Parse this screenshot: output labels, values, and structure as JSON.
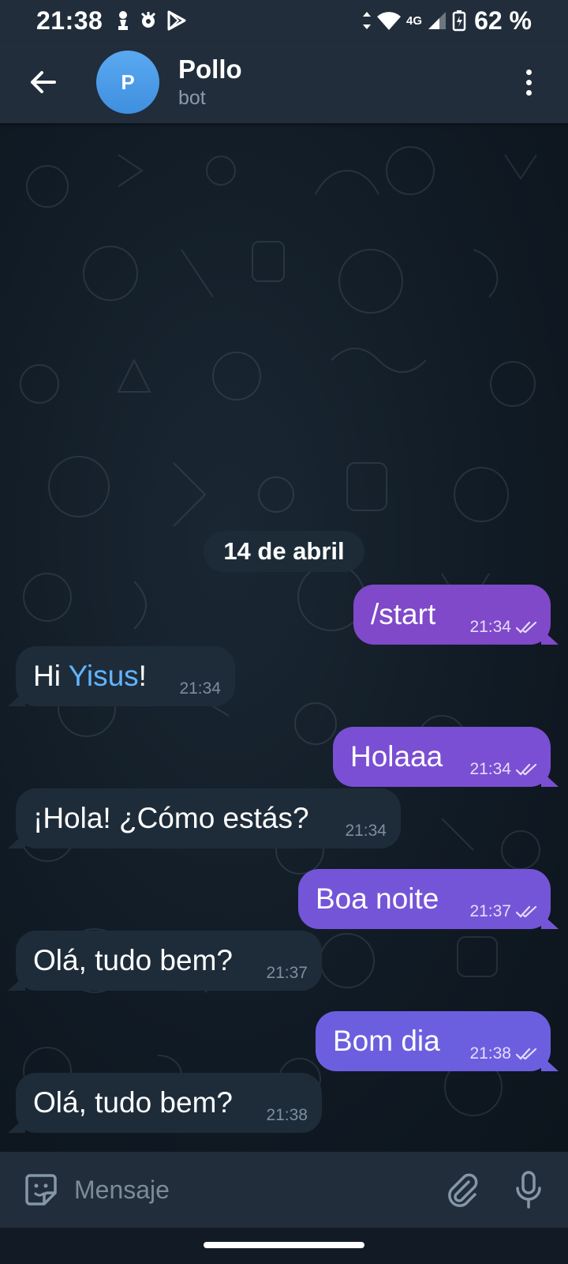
{
  "status_bar": {
    "time": "21:38",
    "network": "4G",
    "battery": "62 %"
  },
  "header": {
    "avatar_letter": "P",
    "title": "Pollo",
    "subtitle": "bot"
  },
  "chat": {
    "date_label": "14 de abril",
    "messages": [
      {
        "direction": "out",
        "text": "/start",
        "time": "21:34",
        "color": "#7f49c9"
      },
      {
        "direction": "in",
        "text_before": "Hi ",
        "link": "Yisus",
        "text_after": "!",
        "time": "21:34"
      },
      {
        "direction": "out",
        "text": "Holaaa",
        "time": "21:34",
        "color": "#7a4fd3"
      },
      {
        "direction": "in",
        "text": "¡Hola! ¿Cómo estás?",
        "time": "21:34"
      },
      {
        "direction": "out",
        "text": "Boa noite",
        "time": "21:37",
        "color": "#7455d8"
      },
      {
        "direction": "in",
        "text": "Olá, tudo bem?",
        "time": "21:37"
      },
      {
        "direction": "out",
        "text": "Bom dia",
        "time": "21:38",
        "color": "#6b5fe0"
      },
      {
        "direction": "in",
        "text": "Olá, tudo bem?",
        "time": "21:38"
      }
    ]
  },
  "composer": {
    "placeholder": "Mensaje"
  },
  "colors": {
    "header_bg": "#212d3b",
    "incoming_bubble": "#1e2c3a",
    "link": "#62b4ff",
    "avatar": "#4a9be8"
  },
  "icons": [
    "back-arrow-icon",
    "more-vert-icon",
    "sticker-icon",
    "attach-icon",
    "mic-icon",
    "wifi-icon",
    "signal-icon",
    "battery-icon",
    "double-check-icon"
  ]
}
